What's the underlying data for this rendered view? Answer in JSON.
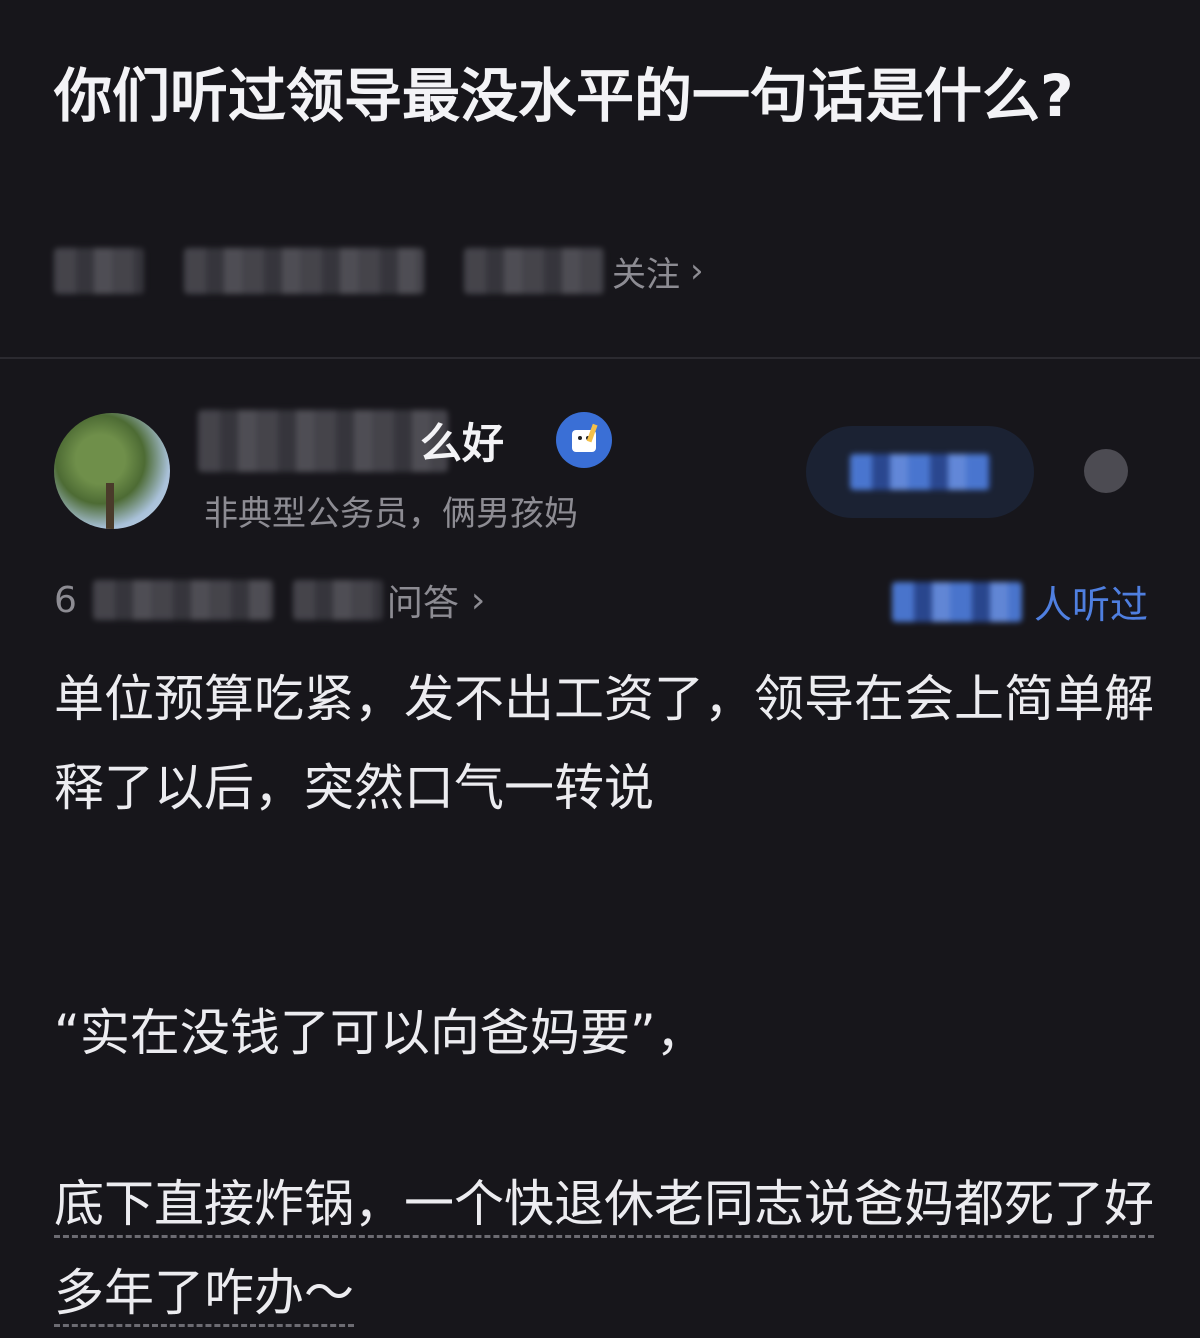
{
  "question": {
    "title": "你们听过领导最没水平的一句话是什么?",
    "meta_visible_text": "关注"
  },
  "author": {
    "name_visible": "么好",
    "subtitle": "非典型公务员，俩男孩妈"
  },
  "stats": {
    "prefix_visible": "6",
    "answers_visible": "问答",
    "heard_suffix": "人听过"
  },
  "answer": {
    "line1": "单位预算吃紧，发不出工资了，领导在会上简单解释了以后，突然口气一转说",
    "quote": "“实在没钱了可以向爸妈要”，",
    "line3": "底下直接炸锅，一个快退休老同志说爸妈都死了好多年了咋办～"
  },
  "icons": {
    "chevron": "chevron-right-icon",
    "badge": "writer-badge-icon",
    "more": "more-icon"
  },
  "colors": {
    "background": "#17161b",
    "accent": "#4f7fe0",
    "muted": "#8d8c93"
  }
}
